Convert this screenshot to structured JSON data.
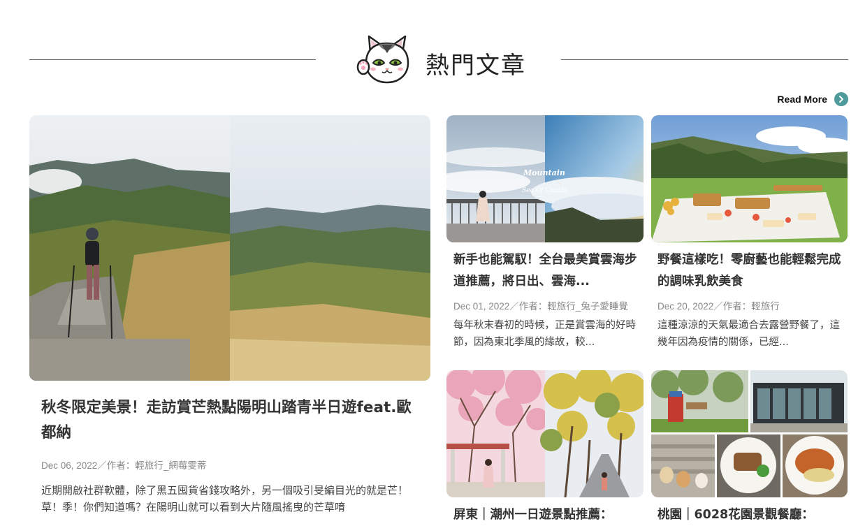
{
  "section": {
    "title": "熱門文章",
    "mascot_icon": "cat-mascot-icon",
    "read_more_label": "Read More",
    "read_more_icon": "chevron-right-icon",
    "accent_color": "#4f9a9a"
  },
  "featured": {
    "title": "秋冬限定美景！走訪賞芒熱點陽明山踏青半日遊feat.歐都納",
    "meta": "Dec 06, 2022／作者：輕旅行_網莓雯蒂",
    "excerpt": "近期開啟社群軟體，除了黑五囤貨省錢攻略外，另一個吸引旻編目光的就是芒！草！季！你們知道嗎？在陽明山就可以看到大片隨風搖曳的芒草唷"
  },
  "articles": [
    {
      "title": "新手也能駕馭！全台最美賞雲海步道推薦，將日出、雲海...",
      "meta": "Dec 01, 2022／作者：輕旅行_兔子愛睡覺",
      "excerpt": "每年秋末春初的時候，正是賞雲海的好時節，因為東北季風的緣故，較...",
      "image_caption": [
        "Mountain",
        "Sea Of Clouds"
      ]
    },
    {
      "title": "野餐這樣吃！零廚藝也能輕鬆完成的調味乳飲美食",
      "meta": "Dec 20, 2022／作者：輕旅行",
      "excerpt": "這種涼涼的天氣最適合去露營野餐了，這幾年因為疫情的關係，已經..."
    },
    {
      "title": "屏東｜潮州一日遊景點推薦："
    },
    {
      "title": "桃園｜6028花園景觀餐廳："
    }
  ]
}
